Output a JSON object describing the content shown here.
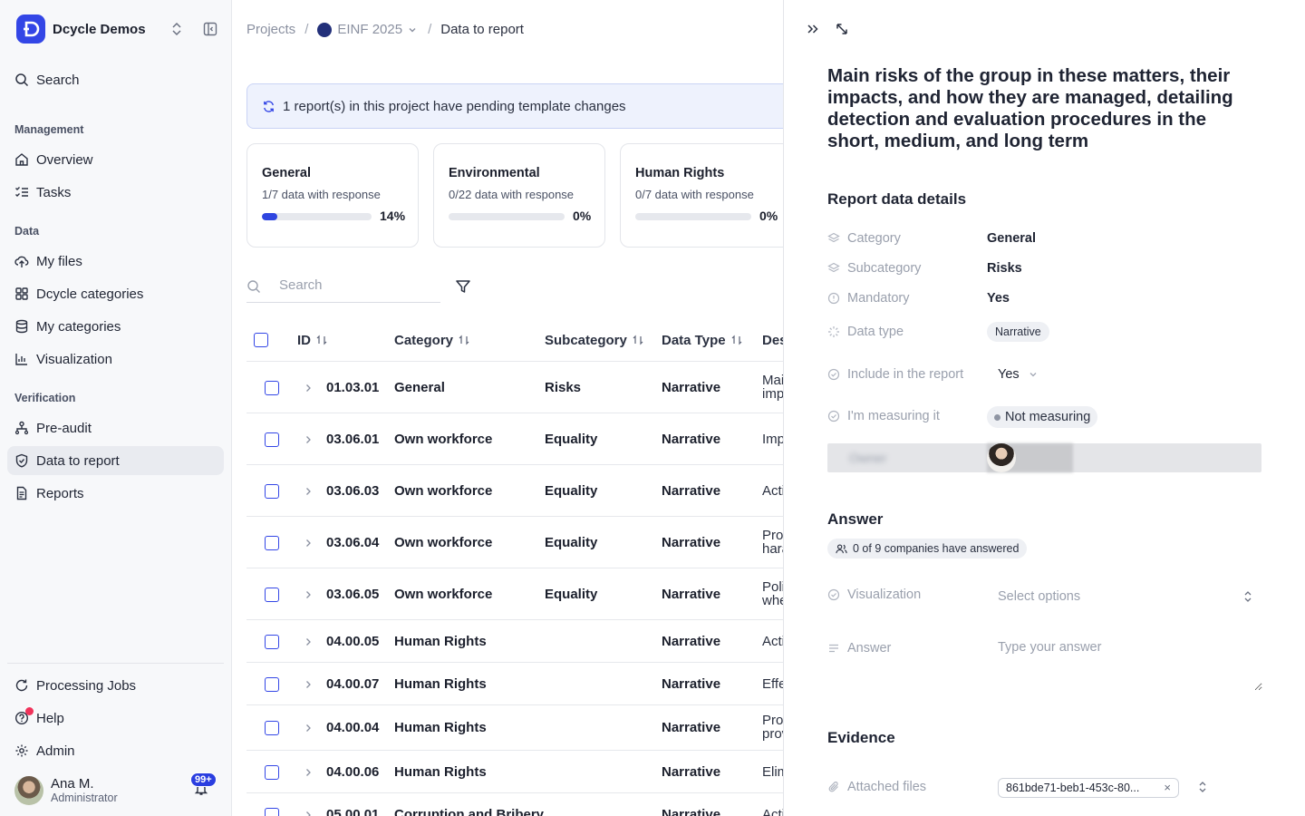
{
  "workspace": {
    "name": "Dcycle Demos"
  },
  "sidebar": {
    "search_label": "Search",
    "sections": {
      "management": "Management",
      "data": "Data",
      "verification": "Verification"
    },
    "items": {
      "overview": "Overview",
      "tasks": "Tasks",
      "my_files": "My files",
      "dcycle_categories": "Dcycle categories",
      "my_categories": "My categories",
      "visualization": "Visualization",
      "pre_audit": "Pre-audit",
      "data_to_report": "Data to report",
      "reports": "Reports",
      "processing_jobs": "Processing Jobs",
      "help": "Help",
      "admin": "Admin"
    },
    "active": "data_to_report"
  },
  "user": {
    "name": "Ana M.",
    "role": "Administrator",
    "notifications": "99+"
  },
  "breadcrumb": {
    "root": "Projects",
    "project": "EINF 2025",
    "current": "Data to report"
  },
  "banner": {
    "text": "1 report(s) in this project have pending template changes"
  },
  "cards": [
    {
      "title": "General",
      "subtitle": "1/7 data with response",
      "percent_label": "14%",
      "progress": 0.14
    },
    {
      "title": "Environmental",
      "subtitle": "0/22 data with response",
      "percent_label": "0%",
      "progress": 0
    },
    {
      "title": "Human Rights",
      "subtitle": "0/7 data with response",
      "percent_label": "0%",
      "progress": 0
    }
  ],
  "table": {
    "search_placeholder": "Search",
    "columns": {
      "id": "ID",
      "category": "Category",
      "subcategory": "Subcategory",
      "data_type": "Data Type",
      "description": "Des"
    },
    "rows": [
      {
        "id": "01.03.01",
        "category": "General",
        "subcategory": "Risks",
        "data_type": "Narrative",
        "desc1": "Mai",
        "desc2": "imp"
      },
      {
        "id": "03.06.01",
        "category": "Own workforce",
        "subcategory": "Equality",
        "data_type": "Narrative",
        "desc1": "Imp",
        "desc2": ""
      },
      {
        "id": "03.06.03",
        "category": "Own workforce",
        "subcategory": "Equality",
        "data_type": "Narrative",
        "desc1": "Acti",
        "desc2": ""
      },
      {
        "id": "03.06.04",
        "category": "Own workforce",
        "subcategory": "Equality",
        "data_type": "Narrative",
        "desc1": "Prot",
        "desc2": "hara"
      },
      {
        "id": "03.06.05",
        "category": "Own workforce",
        "subcategory": "Equality",
        "data_type": "Narrative",
        "desc1": "Poli",
        "desc2": "whe"
      },
      {
        "id": "04.00.05",
        "category": "Human Rights",
        "subcategory": "",
        "data_type": "Narrative",
        "desc1": "Acti",
        "desc2": ""
      },
      {
        "id": "04.00.07",
        "category": "Human Rights",
        "subcategory": "",
        "data_type": "Narrative",
        "desc1": "Effe",
        "desc2": ""
      },
      {
        "id": "04.00.04",
        "category": "Human Rights",
        "subcategory": "",
        "data_type": "Narrative",
        "desc1": "Pron",
        "desc2": "prov"
      },
      {
        "id": "04.00.06",
        "category": "Human Rights",
        "subcategory": "",
        "data_type": "Narrative",
        "desc1": "Elim",
        "desc2": ""
      },
      {
        "id": "05.00.01",
        "category": "Corruption and Bribery",
        "subcategory": "",
        "data_type": "Narrative",
        "desc1": "Acti",
        "desc2": ""
      }
    ]
  },
  "panel": {
    "title": "Main risks of the group in these matters, their impacts, and how they are managed, detailing detection and evaluation procedures in the short, medium, and long term",
    "details_heading": "Report data details",
    "labels": {
      "category": "Category",
      "subcategory": "Subcategory",
      "mandatory": "Mandatory",
      "data_type": "Data type",
      "include": "Include in the report",
      "measuring": "I'm measuring it",
      "owner": "Owner"
    },
    "values": {
      "category": "General",
      "subcategory": "Risks",
      "mandatory": "Yes",
      "data_type": "Narrative",
      "include": "Yes",
      "measuring": "Not measuring",
      "owner": "Ana M."
    },
    "answer_heading": "Answer",
    "answered_badge": "0 of 9 companies have answered",
    "visualization_label": "Visualization",
    "visualization_placeholder": "Select options",
    "answer_label": "Answer",
    "answer_placeholder": "Type your answer",
    "evidence_heading": "Evidence",
    "attached_label": "Attached files",
    "attached_file": "861bde71-beb1-453c-80..."
  }
}
